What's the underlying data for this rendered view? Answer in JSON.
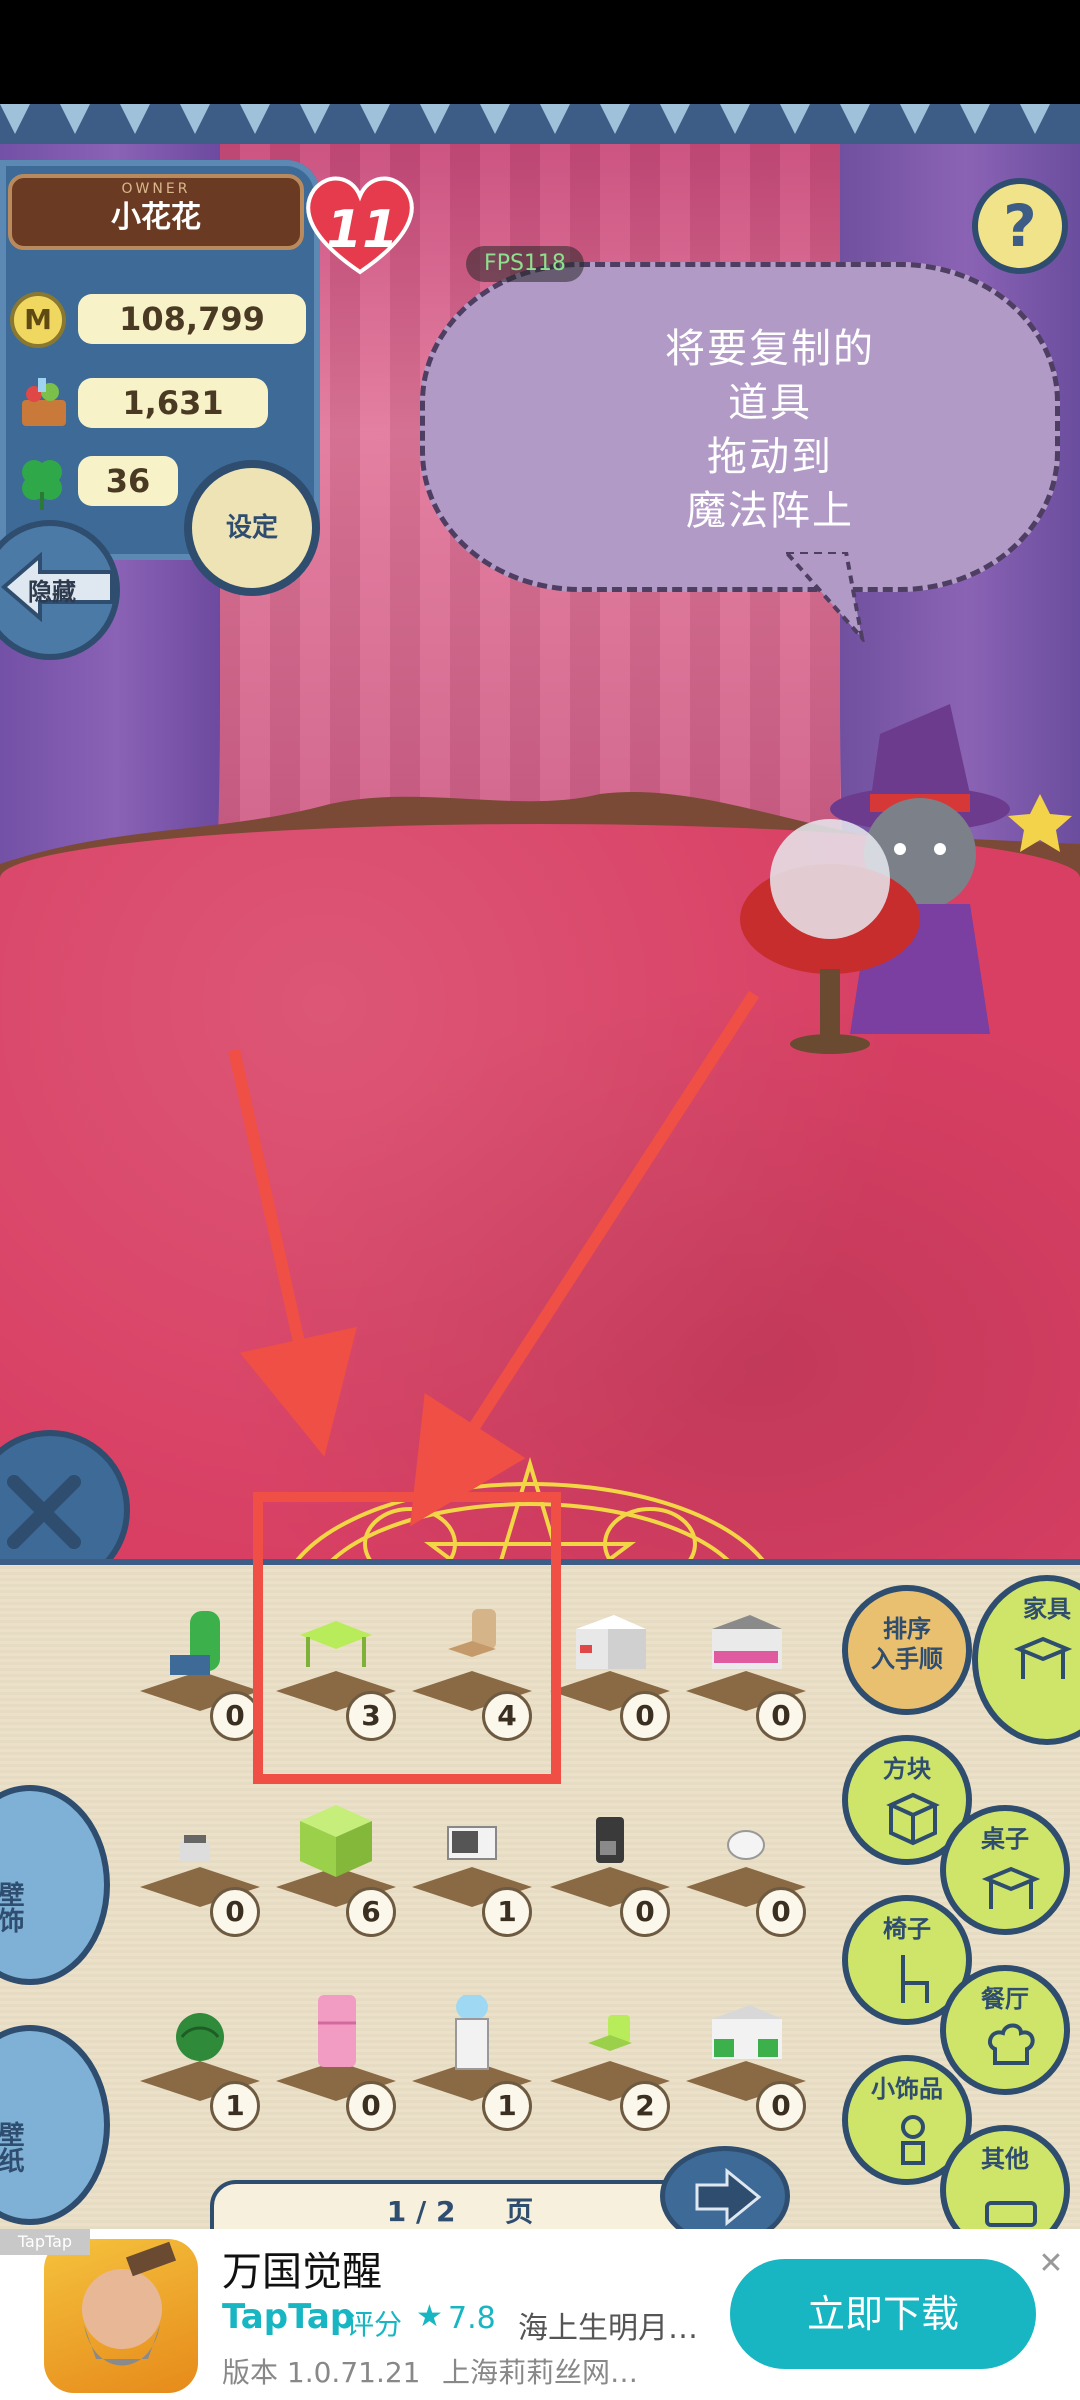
{
  "hud": {
    "owner_label": "OWNER",
    "owner_name": "小花花",
    "heart_level": "11",
    "coins": "108,799",
    "goods": "1,631",
    "clovers": "36",
    "coin_symbol": "M",
    "settings_label": "设定",
    "hide_label": "隐藏",
    "help_symbol": "?",
    "fps": "FPS118"
  },
  "speech": {
    "lines": [
      "将要复制的",
      "道具",
      "拖动到",
      "魔法阵上"
    ]
  },
  "inventory": {
    "rows": [
      [
        {
          "name": "partition",
          "count": "0"
        },
        {
          "name": "green-table",
          "count": "3"
        },
        {
          "name": "wood-chair",
          "count": "4"
        },
        {
          "name": "white-counter",
          "count": "0"
        },
        {
          "name": "stove",
          "count": "0"
        }
      ],
      [
        {
          "name": "register",
          "count": "0"
        },
        {
          "name": "green-cube",
          "count": "6"
        },
        {
          "name": "microwave",
          "count": "1"
        },
        {
          "name": "coffee-maker",
          "count": "0"
        },
        {
          "name": "rice-cooker",
          "count": "0"
        }
      ],
      [
        {
          "name": "watermelon",
          "count": "1"
        },
        {
          "name": "pink-fridge",
          "count": "0"
        },
        {
          "name": "water-cooler",
          "count": "1"
        },
        {
          "name": "green-chair",
          "count": "2"
        },
        {
          "name": "sink",
          "count": "0"
        }
      ]
    ],
    "sort_label_1": "排序",
    "sort_label_2": "入手顺",
    "categories": [
      "家具",
      "方块",
      "桌子",
      "椅子",
      "餐厅",
      "小饰品",
      "其他"
    ],
    "side_tabs": [
      "壁饰",
      "壁纸"
    ],
    "page": "1 / 2",
    "page_suffix": "页"
  },
  "ad": {
    "tag": "TapTap",
    "title": "万国觉醒",
    "brand": "TapTap",
    "rating_label": "评分",
    "star": "★",
    "score": "7.8",
    "description": "海上生明月…",
    "version": "版本 1.0.71.21",
    "developer": "上海莉莉丝网…",
    "cta": "立即下载",
    "close": "✕"
  },
  "colors": {
    "accent": "#17b6c2",
    "annotation": "#ef4f45",
    "panel_blue": "#3d6a96",
    "category_green": "#cfe56a",
    "carpet": "#d83f63"
  }
}
